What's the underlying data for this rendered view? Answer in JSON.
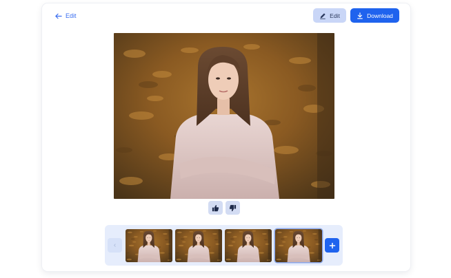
{
  "header": {
    "back_label": "Edit",
    "edit_label": "Edit",
    "download_label": "Download"
  },
  "colors": {
    "accent": "#1f63ee",
    "accent_soft": "#c9d6f7",
    "strip_bg": "#e6edfc"
  },
  "icons": {
    "back": "arrow-left-icon",
    "edit": "pencil-icon",
    "download": "download-icon",
    "like": "thumbs-up-icon",
    "dislike": "thumbs-down-icon",
    "prev": "chevron-left-icon",
    "add": "plus-icon"
  },
  "strip": {
    "prev_glyph": "‹",
    "thumbnails": [
      {
        "selected": false
      },
      {
        "selected": false
      },
      {
        "selected": false
      },
      {
        "selected": true
      }
    ]
  }
}
